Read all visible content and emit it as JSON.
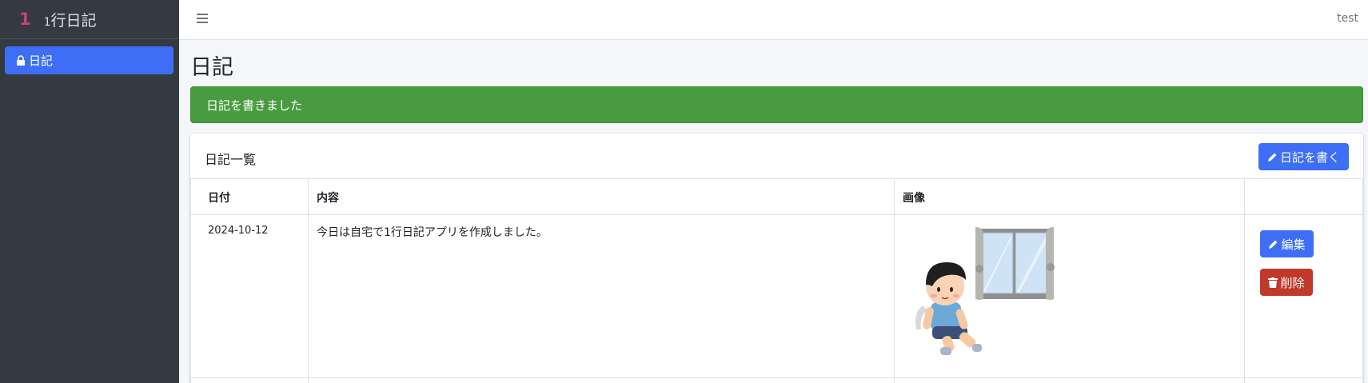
{
  "brand": {
    "logo": "1",
    "name_prefix": "1",
    "name_rest": "行日記"
  },
  "sidebar": {
    "items": [
      {
        "label": "日記",
        "icon": "lock-icon",
        "active": true
      }
    ]
  },
  "topbar": {
    "user": "test"
  },
  "page": {
    "title": "日記"
  },
  "alert": {
    "message": "日記を書きました",
    "color": "#489c3f"
  },
  "card": {
    "title": "日記一覧",
    "write_button": "日記を書く",
    "columns": [
      "日付",
      "内容",
      "画像",
      ""
    ],
    "rows": [
      {
        "date": "2024-10-12",
        "content": "今日は自宅で1行日記アプリを作成しました。",
        "image": "boy-sitting-by-window-illustration",
        "edit_label": "編集",
        "delete_label": "削除"
      }
    ]
  },
  "colors": {
    "primary": "#3d6ef5",
    "danger": "#c0392b",
    "success": "#489c3f",
    "sidebar": "#343a40"
  }
}
